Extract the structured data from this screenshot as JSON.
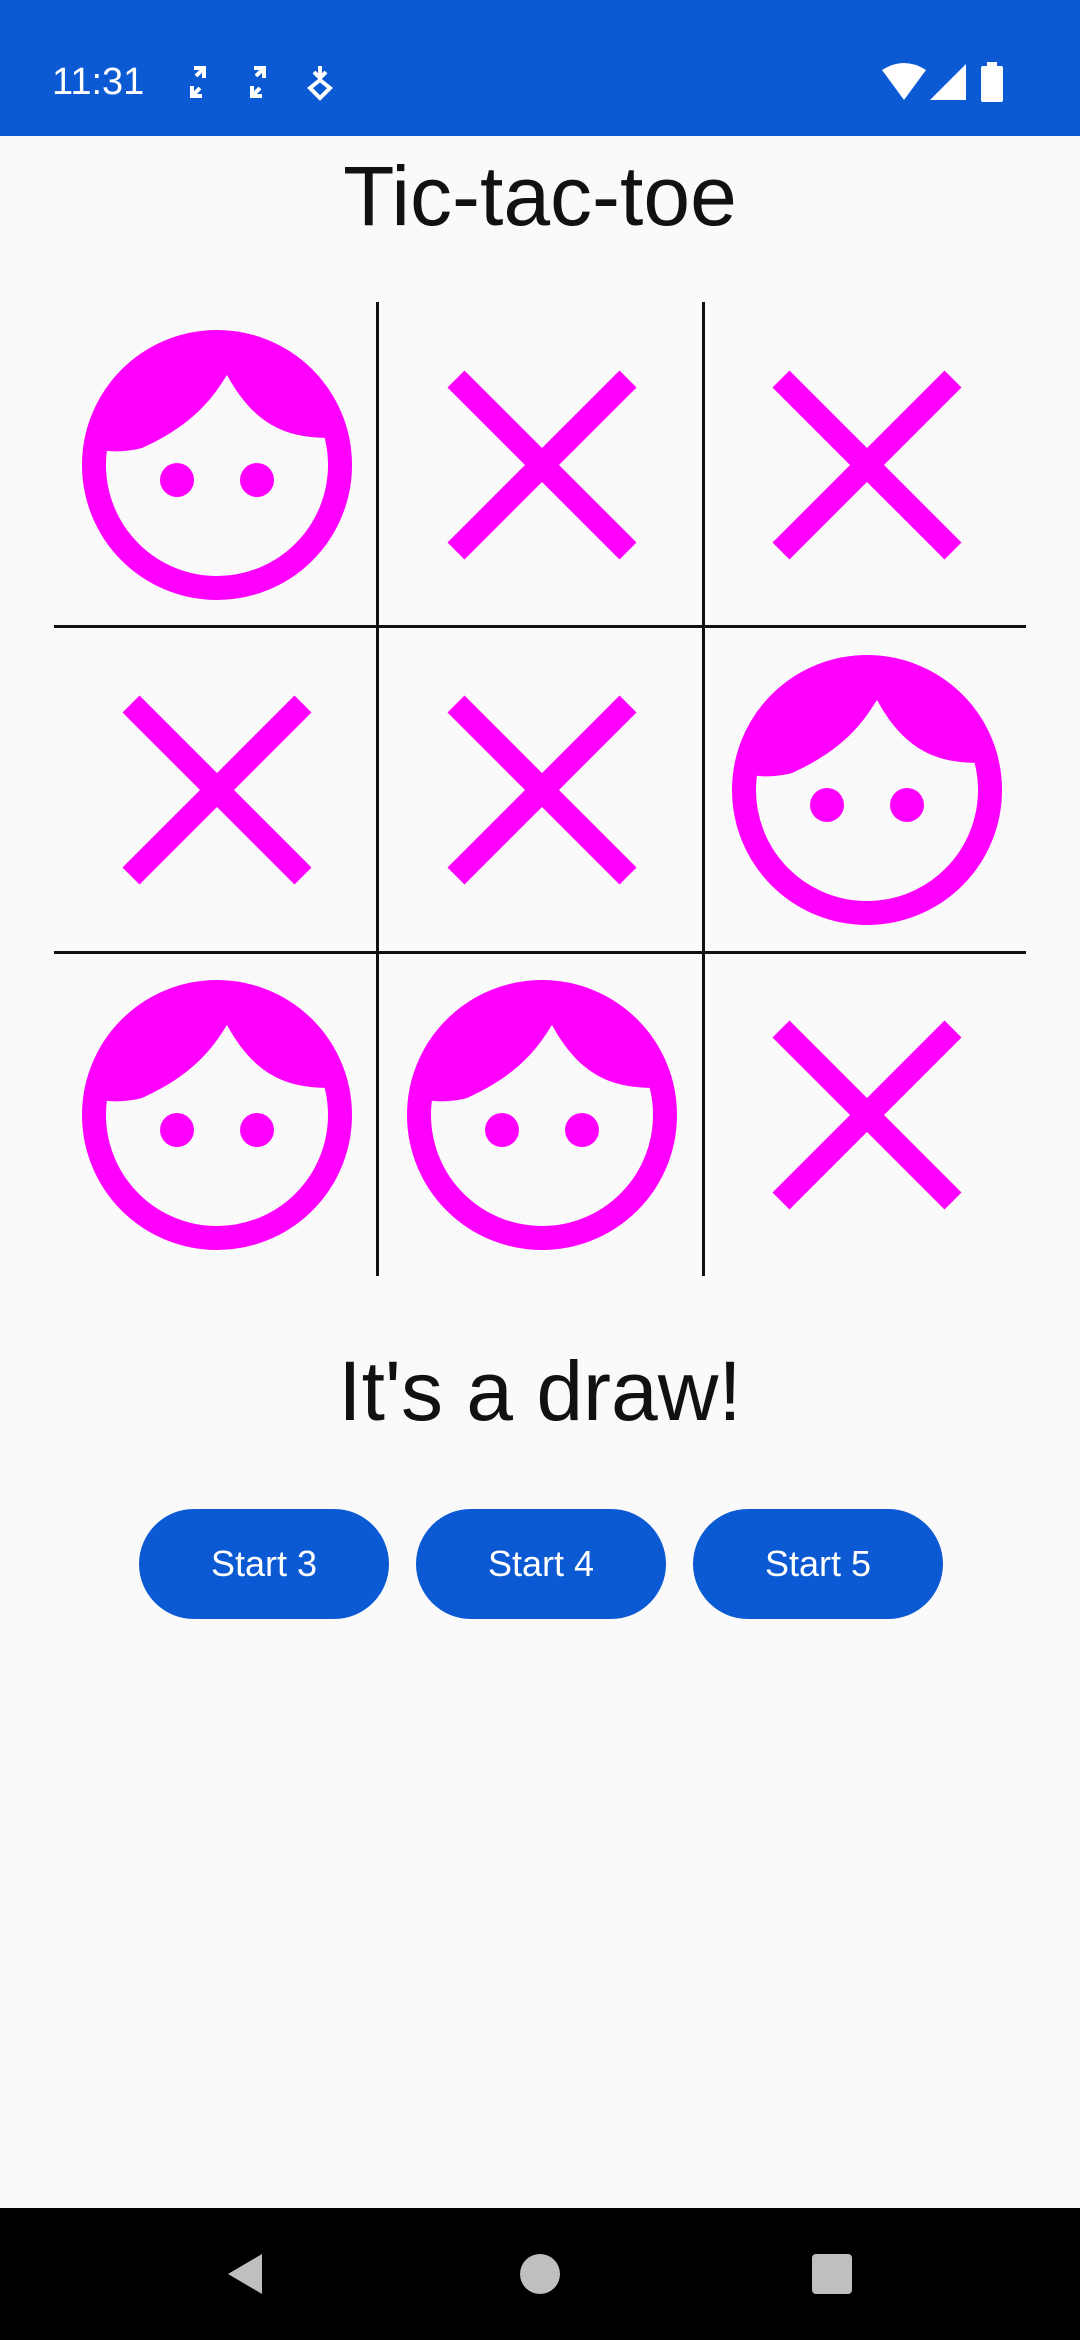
{
  "status_bar": {
    "time": "11:31",
    "left_icons": [
      "sync-arrows-icon",
      "sync-arrows-icon",
      "notification-download-icon"
    ],
    "right_icons": [
      "wifi-icon",
      "signal-icon",
      "battery-icon"
    ],
    "background_color": "#0b5ad3"
  },
  "app": {
    "title": "Tic-tac-toe",
    "result": "It's a draw!"
  },
  "board": {
    "mark_color": "#ff00ff",
    "cells": [
      [
        "O",
        "X",
        "X"
      ],
      [
        "X",
        "X",
        "O"
      ],
      [
        "O",
        "O",
        "X"
      ]
    ],
    "mark_icons": {
      "X": "cross-mark-icon",
      "O": "face-mark-icon"
    }
  },
  "buttons": {
    "start3": "Start 3",
    "start4": "Start 4",
    "start5": "Start 5",
    "color": "#0b5ad3"
  },
  "nav_bar": {
    "icons": [
      "back-triangle-icon",
      "home-circle-icon",
      "recents-square-icon"
    ]
  }
}
